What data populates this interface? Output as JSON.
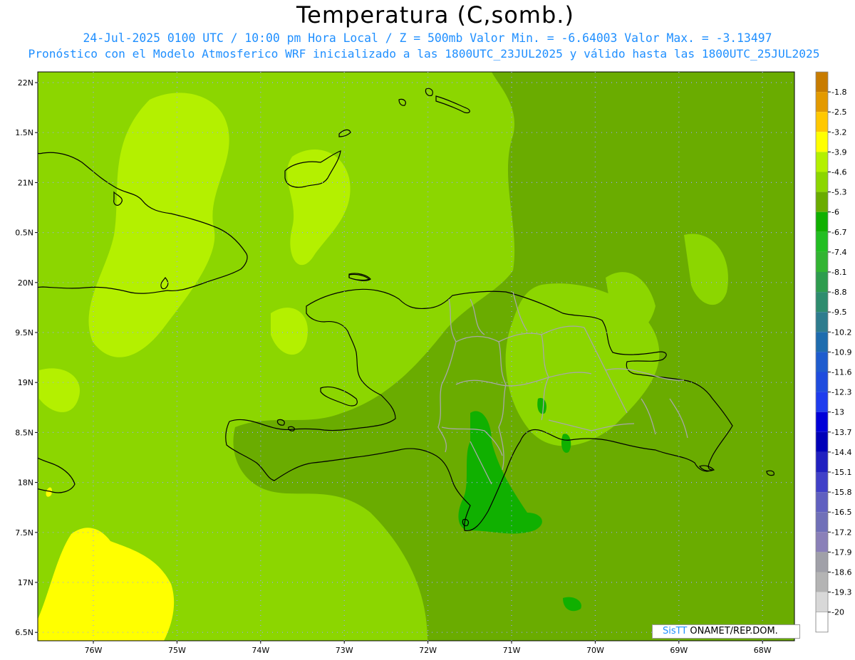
{
  "header": {
    "title": "Temperatura (C,somb.)",
    "line1": "24-Jul-2025  0100 UTC / 10:00 pm Hora Local / Z = 500mb  Valor Min. = -6.64003  Valor Max. = -3.13497",
    "line2": "Pronóstico con el Modelo Atmosferico WRF inicializado a las 1800UTC_23JUL2025 y válido hasta las  1800UTC_25JUL2025"
  },
  "map": {
    "lat_labels": [
      "22N",
      "1.5N",
      "21N",
      "0.5N",
      "20N",
      "9.5N",
      "19N",
      "8.5N",
      "18N",
      "7.5N",
      "17N",
      "6.5N"
    ],
    "lon_labels": [
      "76W",
      "75W",
      "74W",
      "73W",
      "72W",
      "71W",
      "70W",
      "69W",
      "68W"
    ]
  },
  "colorbar": {
    "labels": [
      "-1.8",
      "-2.5",
      "-3.2",
      "-3.9",
      "-4.6",
      "-5.3",
      "-6",
      "-6.7",
      "-7.4",
      "-8.1",
      "-8.8",
      "-9.5",
      "-10.2",
      "-10.9",
      "-11.6",
      "-12.3",
      "-13",
      "-13.7",
      "-14.4",
      "-15.1",
      "-15.8",
      "-16.5",
      "-17.2",
      "-17.9",
      "-18.6",
      "-19.3",
      "-20"
    ],
    "colors": [
      "#c87c00",
      "#e39a00",
      "#ffc800",
      "#ffff00",
      "#b4f000",
      "#8cd600",
      "#6aac00",
      "#10b000",
      "#22be22",
      "#32b432",
      "#2e9c4e",
      "#2e8c6e",
      "#2e7c8e",
      "#1e6cae",
      "#1e5cce",
      "#1e4cde",
      "#1e3cee",
      "#0000d8",
      "#0000b8",
      "#2020c0",
      "#4040c8",
      "#6060c0",
      "#7070b8",
      "#8a80b8",
      "#a0a0a8",
      "#b4b4b4",
      "#d8d8d8"
    ],
    "bottom_color": "#ffffff"
  },
  "credit": {
    "brand": "SisTT",
    "text": " ONAMET/REP.DOM."
  }
}
